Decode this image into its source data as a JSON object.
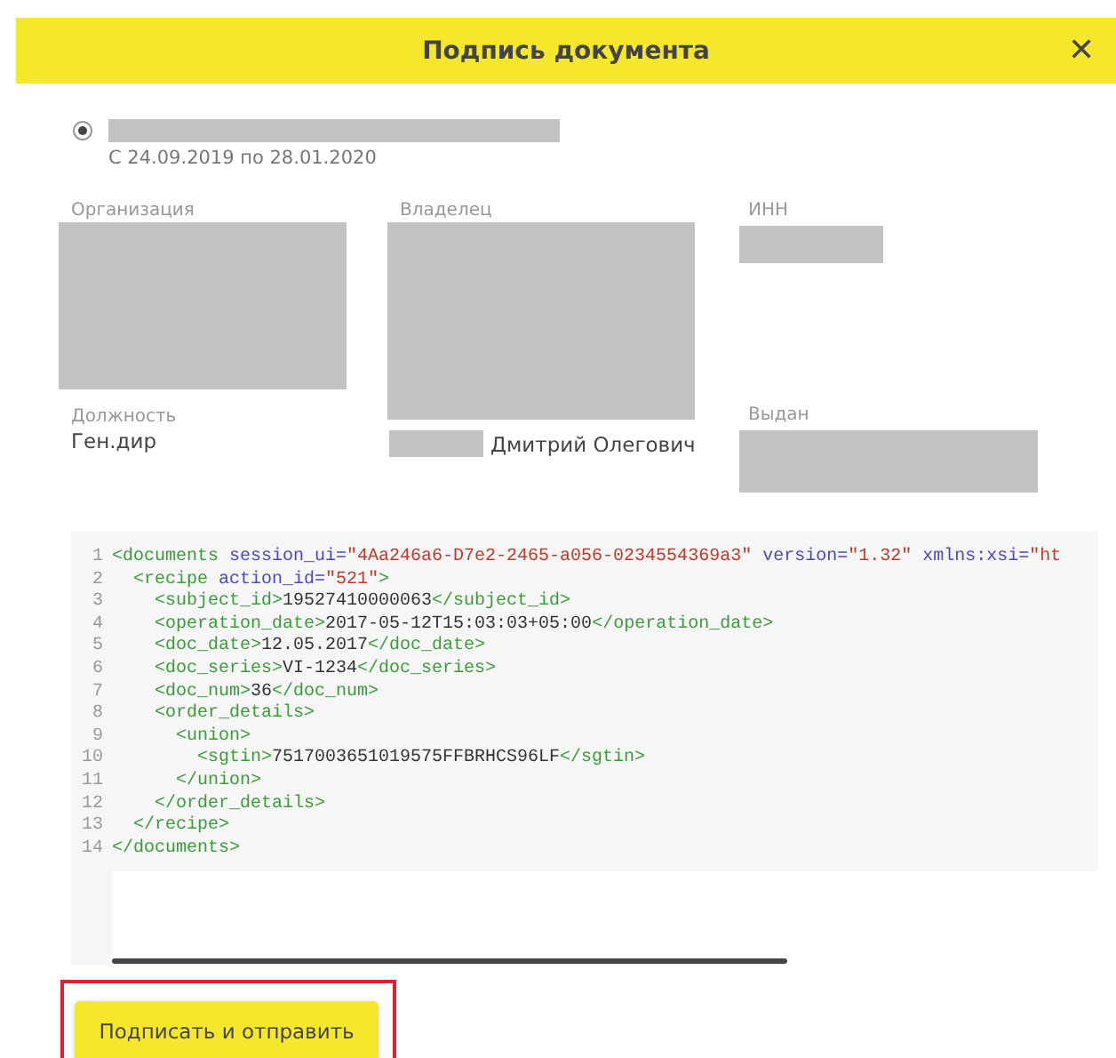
{
  "dialog": {
    "title": "Подпись документа",
    "close": "✕"
  },
  "certificate": {
    "selected": true,
    "validity": "С 24.09.2019 по 28.01.2020"
  },
  "fields": {
    "organization_label": "Организация",
    "owner_label": "Владелец",
    "inn_label": "ИНН",
    "position_label": "Должность",
    "position_value": "Ген.дир",
    "owner_name": "Дмитрий Олегович",
    "issued_label": "Выдан"
  },
  "code": [
    {
      "number": "1",
      "tokens": [
        {
          "kind": "tag",
          "text": "<documents"
        },
        {
          "kind": "attr",
          "text": " session_ui="
        },
        {
          "kind": "value",
          "text": "\"4Aa246a6-D7e2-2465-a056-0234554369a3\""
        },
        {
          "kind": "attr",
          "text": " version="
        },
        {
          "kind": "value",
          "text": "\"1.32\""
        },
        {
          "kind": "attr",
          "text": " xmlns:xsi="
        },
        {
          "kind": "value",
          "text": "\"ht"
        }
      ]
    },
    {
      "number": "2",
      "tokens": [
        {
          "kind": "tag",
          "text": "  <recipe"
        },
        {
          "kind": "attr",
          "text": " action_id="
        },
        {
          "kind": "value",
          "text": "\"521\""
        },
        {
          "kind": "tag",
          "text": ">"
        }
      ]
    },
    {
      "number": "3",
      "tokens": [
        {
          "kind": "tag",
          "text": "    <subject_id>"
        },
        {
          "kind": "text",
          "text": "19527410000063"
        },
        {
          "kind": "tag",
          "text": "</subject_id>"
        }
      ]
    },
    {
      "number": "4",
      "tokens": [
        {
          "kind": "tag",
          "text": "    <operation_date>"
        },
        {
          "kind": "text",
          "text": "2017-05-12T15:03:03+05:00"
        },
        {
          "kind": "tag",
          "text": "</operation_date>"
        }
      ]
    },
    {
      "number": "5",
      "tokens": [
        {
          "kind": "tag",
          "text": "    <doc_date>"
        },
        {
          "kind": "text",
          "text": "12.05.2017"
        },
        {
          "kind": "tag",
          "text": "</doc_date>"
        }
      ]
    },
    {
      "number": "6",
      "tokens": [
        {
          "kind": "tag",
          "text": "    <doc_series>"
        },
        {
          "kind": "text",
          "text": "VI-1234"
        },
        {
          "kind": "tag",
          "text": "</doc_series>"
        }
      ]
    },
    {
      "number": "7",
      "tokens": [
        {
          "kind": "tag",
          "text": "    <doc_num>"
        },
        {
          "kind": "text",
          "text": "36"
        },
        {
          "kind": "tag",
          "text": "</doc_num>"
        }
      ]
    },
    {
      "number": "8",
      "tokens": [
        {
          "kind": "tag",
          "text": "    <order_details>"
        }
      ]
    },
    {
      "number": "9",
      "tokens": [
        {
          "kind": "tag",
          "text": "      <union>"
        }
      ]
    },
    {
      "number": "10",
      "tokens": [
        {
          "kind": "tag",
          "text": "        <sgtin>"
        },
        {
          "kind": "text",
          "text": "7517003651019575FFBRHCS96LF"
        },
        {
          "kind": "tag",
          "text": "</sgtin>"
        }
      ]
    },
    {
      "number": "11",
      "tokens": [
        {
          "kind": "tag",
          "text": "      </union>"
        }
      ]
    },
    {
      "number": "12",
      "tokens": [
        {
          "kind": "tag",
          "text": "    </order_details>"
        }
      ]
    },
    {
      "number": "13",
      "tokens": [
        {
          "kind": "tag",
          "text": "  </recipe>"
        }
      ]
    },
    {
      "number": "14",
      "tokens": [
        {
          "kind": "tag",
          "text": "</documents>"
        }
      ]
    }
  ],
  "submit_button": {
    "label": "Подписать и отправить",
    "highlighted": true
  }
}
